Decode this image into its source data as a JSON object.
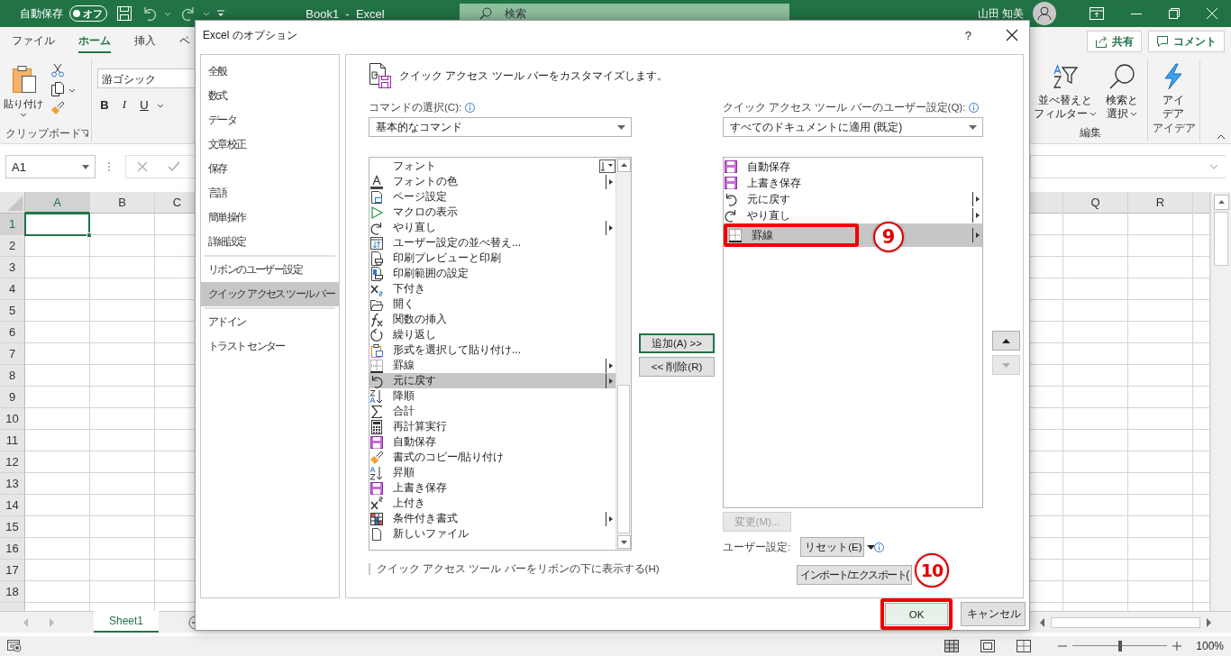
{
  "title_bar": {
    "autosave": {
      "label": "自動保存",
      "toggle_text": "オフ",
      "on": false
    },
    "document_title": "Book1  -  Excel",
    "search": {
      "placeholder": "検索"
    },
    "user_name": "山田 知美"
  },
  "ribbon": {
    "tabs": [
      {
        "label": "ファイル",
        "selected": false
      },
      {
        "label": "ホーム",
        "selected": true
      },
      {
        "label": "挿入",
        "selected": false
      },
      {
        "label": "ペ",
        "selected": false
      }
    ],
    "share_button": "共有",
    "comment_button": "コメント",
    "clipboard": {
      "paste_label": "貼り付け",
      "group_label": "クリップボード"
    },
    "font": {
      "font_name": "游ゴシック",
      "style_buttons": [
        "B",
        "I",
        "U"
      ]
    },
    "editing": {
      "sort_filter": [
        "並べ替えと",
        "フィルター"
      ],
      "find_select": [
        "検索と",
        "選択"
      ],
      "group_label": "編集"
    },
    "ideas": {
      "button": [
        "アイ",
        "デア"
      ],
      "group_label": "アイデア"
    }
  },
  "formula_bar": {
    "name_box": "A1"
  },
  "sheet": {
    "columns_left": [
      {
        "label": "A",
        "selected": true
      },
      {
        "label": "B",
        "selected": false
      },
      {
        "label": "C",
        "selected": false
      }
    ],
    "columns_right": [
      {
        "label": "Q",
        "selected": false
      },
      {
        "label": "R",
        "selected": false
      }
    ],
    "rows": [
      {
        "label": "1",
        "selected": true
      },
      {
        "label": "2",
        "selected": false
      },
      {
        "label": "3",
        "selected": false
      },
      {
        "label": "4",
        "selected": false
      },
      {
        "label": "5",
        "selected": false
      },
      {
        "label": "6",
        "selected": false
      },
      {
        "label": "7",
        "selected": false
      },
      {
        "label": "8",
        "selected": false
      },
      {
        "label": "9",
        "selected": false
      },
      {
        "label": "10",
        "selected": false
      },
      {
        "label": "11",
        "selected": false
      },
      {
        "label": "12",
        "selected": false
      },
      {
        "label": "13",
        "selected": false
      },
      {
        "label": "14",
        "selected": false
      },
      {
        "label": "15",
        "selected": false
      },
      {
        "label": "16",
        "selected": false
      },
      {
        "label": "17",
        "selected": false
      },
      {
        "label": "18",
        "selected": false
      }
    ]
  },
  "sheet_tabs": [
    {
      "label": "Sheet1",
      "selected": true
    }
  ],
  "status_bar": {
    "zoom_slider": {
      "level": 0.5
    },
    "zoom": "100%"
  },
  "dialog": {
    "title": "Excel のオプション",
    "help_button": "?",
    "nav_groups": [
      [
        {
          "label": "全般",
          "selected": false
        },
        {
          "label": "数式",
          "selected": false
        },
        {
          "label": "データ",
          "selected": false
        },
        {
          "label": "文章校正",
          "selected": false
        },
        {
          "label": "保存",
          "selected": false
        },
        {
          "label": "言語",
          "selected": false
        },
        {
          "label": "簡単操作",
          "selected": false
        },
        {
          "label": "詳細設定",
          "selected": false
        }
      ],
      [
        {
          "label": "リボンのユーザー設定",
          "selected": false
        },
        {
          "label": "クイック アクセス ツール バー",
          "selected": true
        }
      ],
      [
        {
          "label": "アドイン",
          "selected": false
        },
        {
          "label": "トラスト センター",
          "selected": false
        }
      ]
    ],
    "heading": "クイック アクセス ツール バーをカスタマイズします。",
    "commands_label": "コマンドの選択(C):",
    "commands_select": "基本的なコマンド",
    "commands": [
      {
        "label": "フォント",
        "kind": "combo",
        "selected": false
      },
      {
        "label": "フォントの色",
        "kind": "submenu",
        "selected": false
      },
      {
        "label": "ページ設定",
        "kind": "plain",
        "selected": false
      },
      {
        "label": "マクロの表示",
        "kind": "plain",
        "selected": false
      },
      {
        "label": "やり直し",
        "kind": "submenu",
        "selected": false
      },
      {
        "label": "ユーザー設定の並べ替え...",
        "kind": "plain",
        "selected": false
      },
      {
        "label": "印刷プレビューと印刷",
        "kind": "plain",
        "selected": false
      },
      {
        "label": "印刷範囲の設定",
        "kind": "plain",
        "selected": false
      },
      {
        "label": "下付き",
        "kind": "plain",
        "selected": false
      },
      {
        "label": "開く",
        "kind": "plain",
        "selected": false
      },
      {
        "label": "関数の挿入",
        "kind": "plain",
        "selected": false
      },
      {
        "label": "繰り返し",
        "kind": "plain",
        "selected": false
      },
      {
        "label": "形式を選択して貼り付け...",
        "kind": "plain",
        "selected": false
      },
      {
        "label": "罫線",
        "kind": "submenu",
        "selected": false
      },
      {
        "label": "元に戻す",
        "kind": "submenu",
        "selected": true
      },
      {
        "label": "降順",
        "kind": "plain",
        "selected": false
      },
      {
        "label": "合計",
        "kind": "plain",
        "selected": false
      },
      {
        "label": "再計算実行",
        "kind": "plain",
        "selected": false
      },
      {
        "label": "自動保存",
        "kind": "plain",
        "selected": false
      },
      {
        "label": "書式のコピー/貼り付け",
        "kind": "plain",
        "selected": false
      },
      {
        "label": "昇順",
        "kind": "plain",
        "selected": false
      },
      {
        "label": "上書き保存",
        "kind": "plain",
        "selected": false
      },
      {
        "label": "上付き",
        "kind": "plain",
        "selected": false
      },
      {
        "label": "条件付き書式",
        "kind": "submenu",
        "selected": false
      },
      {
        "label": "新しいファイル",
        "kind": "plain",
        "selected": false
      }
    ],
    "add_button": "追加(A) >>",
    "remove_button": "<< 削除(R)",
    "qat_label": "クイック アクセス ツール バーのユーザー設定(Q):",
    "qat_select": "すべてのドキュメントに適用 (既定)",
    "qat_items": [
      {
        "label": "自動保存",
        "kind": "plain",
        "selected": false,
        "highlighted": false
      },
      {
        "label": "上書き保存",
        "kind": "plain",
        "selected": false,
        "highlighted": false
      },
      {
        "label": "元に戻す",
        "kind": "submenu",
        "selected": false,
        "highlighted": false
      },
      {
        "label": "やり直し",
        "kind": "submenu",
        "selected": false,
        "highlighted": false
      },
      {
        "label": "罫線",
        "kind": "submenu",
        "selected": true,
        "highlighted": true
      }
    ],
    "move_up": {
      "disabled": false
    },
    "move_down": {
      "disabled": true
    },
    "modify_button": {
      "label": "変更(M)...",
      "disabled": true
    },
    "customizations_label": "ユーザー設定:",
    "reset_button": "リセット(E)",
    "import_export_button": "インポート/エクスポート(",
    "below_ribbon_checkbox": {
      "label": "クイック アクセス ツール バーをリボンの下に表示する(H)",
      "checked": false
    },
    "ok_button": {
      "label": "OK",
      "highlighted": true
    },
    "cancel_button": "キャンセル",
    "callouts": [
      "9",
      "10"
    ]
  }
}
